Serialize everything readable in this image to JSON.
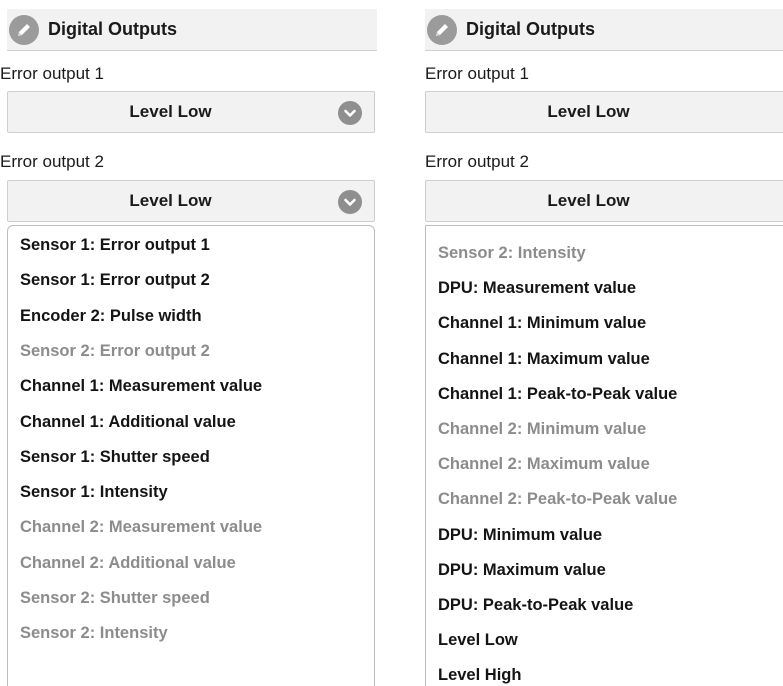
{
  "left_panel": {
    "header": {
      "title": "Digital Outputs",
      "icon": "pencil-icon"
    },
    "error_output_1": {
      "label": "Error output 1",
      "value": "Level Low"
    },
    "error_output_2": {
      "label": "Error output 2",
      "value": "Level Low"
    },
    "options": [
      {
        "label": "Sensor 1: Error output 1",
        "enabled": true
      },
      {
        "label": "Sensor 1: Error output 2",
        "enabled": true
      },
      {
        "label": "Encoder 2: Pulse width",
        "enabled": true
      },
      {
        "label": "Sensor 2: Error output 2",
        "enabled": false
      },
      {
        "label": "Channel 1: Measurement value",
        "enabled": true
      },
      {
        "label": "Channel 1: Additional value",
        "enabled": true
      },
      {
        "label": "Sensor 1: Shutter speed",
        "enabled": true
      },
      {
        "label": "Sensor 1: Intensity",
        "enabled": true
      },
      {
        "label": "Channel 2: Measurement value",
        "enabled": false
      },
      {
        "label": "Channel 2: Additional value",
        "enabled": false
      },
      {
        "label": "Sensor 2: Shutter speed",
        "enabled": false
      },
      {
        "label": "Sensor 2: Intensity",
        "enabled": false
      }
    ]
  },
  "right_panel": {
    "header": {
      "title": "Digital Outputs",
      "icon": "pencil-icon"
    },
    "error_output_1": {
      "label": "Error output 1",
      "value": "Level Low"
    },
    "error_output_2": {
      "label": "Error output 2",
      "value": "Level Low"
    },
    "options": [
      {
        "label": "Sensor 2: Intensity",
        "enabled": false
      },
      {
        "label": "DPU: Measurement value",
        "enabled": true
      },
      {
        "label": "Channel 1: Minimum value",
        "enabled": true
      },
      {
        "label": "Channel 1: Maximum value",
        "enabled": true
      },
      {
        "label": "Channel 1: Peak-to-Peak value",
        "enabled": true
      },
      {
        "label": "Channel 2: Minimum value",
        "enabled": false
      },
      {
        "label": "Channel 2: Maximum value",
        "enabled": false
      },
      {
        "label": "Channel 2: Peak-to-Peak value",
        "enabled": false
      },
      {
        "label": "DPU: Minimum value",
        "enabled": true
      },
      {
        "label": "DPU: Maximum value",
        "enabled": true
      },
      {
        "label": "DPU: Peak-to-Peak value",
        "enabled": true
      },
      {
        "label": "Level Low",
        "enabled": true
      },
      {
        "label": "Level High",
        "enabled": true
      }
    ]
  },
  "colors": {
    "header_bg": "#f2f2f2",
    "badge_gray": "#8f8f8f",
    "disabled_text": "#8c8c8c",
    "enabled_text": "#141414"
  }
}
